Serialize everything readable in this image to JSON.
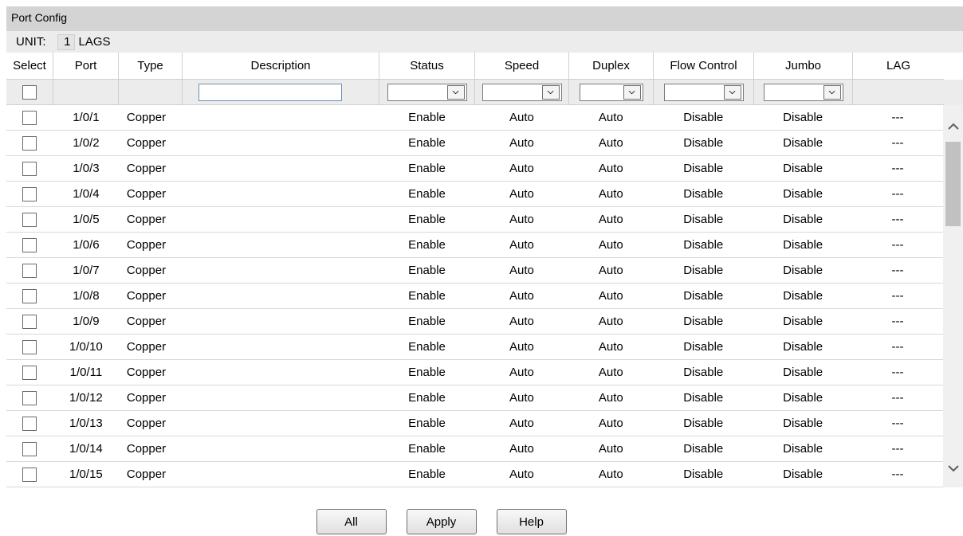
{
  "panel": {
    "title": "Port Config"
  },
  "unit": {
    "label": "UNIT:",
    "value": "1",
    "lags_link": "LAGS"
  },
  "columns": [
    "Select",
    "Port",
    "Type",
    "Description",
    "Status",
    "Speed",
    "Duplex",
    "Flow Control",
    "Jumbo",
    "LAG"
  ],
  "filter": {
    "description": "",
    "status": "",
    "speed": "",
    "duplex": "",
    "flow_control": "",
    "jumbo": ""
  },
  "rows": [
    {
      "port": "1/0/1",
      "type": "Copper",
      "description": "",
      "status": "Enable",
      "speed": "Auto",
      "duplex": "Auto",
      "flow_control": "Disable",
      "jumbo": "Disable",
      "lag": "---"
    },
    {
      "port": "1/0/2",
      "type": "Copper",
      "description": "",
      "status": "Enable",
      "speed": "Auto",
      "duplex": "Auto",
      "flow_control": "Disable",
      "jumbo": "Disable",
      "lag": "---"
    },
    {
      "port": "1/0/3",
      "type": "Copper",
      "description": "",
      "status": "Enable",
      "speed": "Auto",
      "duplex": "Auto",
      "flow_control": "Disable",
      "jumbo": "Disable",
      "lag": "---"
    },
    {
      "port": "1/0/4",
      "type": "Copper",
      "description": "",
      "status": "Enable",
      "speed": "Auto",
      "duplex": "Auto",
      "flow_control": "Disable",
      "jumbo": "Disable",
      "lag": "---"
    },
    {
      "port": "1/0/5",
      "type": "Copper",
      "description": "",
      "status": "Enable",
      "speed": "Auto",
      "duplex": "Auto",
      "flow_control": "Disable",
      "jumbo": "Disable",
      "lag": "---"
    },
    {
      "port": "1/0/6",
      "type": "Copper",
      "description": "",
      "status": "Enable",
      "speed": "Auto",
      "duplex": "Auto",
      "flow_control": "Disable",
      "jumbo": "Disable",
      "lag": "---"
    },
    {
      "port": "1/0/7",
      "type": "Copper",
      "description": "",
      "status": "Enable",
      "speed": "Auto",
      "duplex": "Auto",
      "flow_control": "Disable",
      "jumbo": "Disable",
      "lag": "---"
    },
    {
      "port": "1/0/8",
      "type": "Copper",
      "description": "",
      "status": "Enable",
      "speed": "Auto",
      "duplex": "Auto",
      "flow_control": "Disable",
      "jumbo": "Disable",
      "lag": "---"
    },
    {
      "port": "1/0/9",
      "type": "Copper",
      "description": "",
      "status": "Enable",
      "speed": "Auto",
      "duplex": "Auto",
      "flow_control": "Disable",
      "jumbo": "Disable",
      "lag": "---"
    },
    {
      "port": "1/0/10",
      "type": "Copper",
      "description": "",
      "status": "Enable",
      "speed": "Auto",
      "duplex": "Auto",
      "flow_control": "Disable",
      "jumbo": "Disable",
      "lag": "---"
    },
    {
      "port": "1/0/11",
      "type": "Copper",
      "description": "",
      "status": "Enable",
      "speed": "Auto",
      "duplex": "Auto",
      "flow_control": "Disable",
      "jumbo": "Disable",
      "lag": "---"
    },
    {
      "port": "1/0/12",
      "type": "Copper",
      "description": "",
      "status": "Enable",
      "speed": "Auto",
      "duplex": "Auto",
      "flow_control": "Disable",
      "jumbo": "Disable",
      "lag": "---"
    },
    {
      "port": "1/0/13",
      "type": "Copper",
      "description": "",
      "status": "Enable",
      "speed": "Auto",
      "duplex": "Auto",
      "flow_control": "Disable",
      "jumbo": "Disable",
      "lag": "---"
    },
    {
      "port": "1/0/14",
      "type": "Copper",
      "description": "",
      "status": "Enable",
      "speed": "Auto",
      "duplex": "Auto",
      "flow_control": "Disable",
      "jumbo": "Disable",
      "lag": "---"
    },
    {
      "port": "1/0/15",
      "type": "Copper",
      "description": "",
      "status": "Enable",
      "speed": "Auto",
      "duplex": "Auto",
      "flow_control": "Disable",
      "jumbo": "Disable",
      "lag": "---"
    }
  ],
  "scrollbar": {
    "up_icon": "chevron-up-icon",
    "down_icon": "chevron-down-icon"
  },
  "buttons": {
    "all": "All",
    "apply": "Apply",
    "help": "Help"
  },
  "colors": {
    "title_bar": "#d4d4d4",
    "filter_bar": "#ececec",
    "row_divider": "#d8d8d8"
  }
}
